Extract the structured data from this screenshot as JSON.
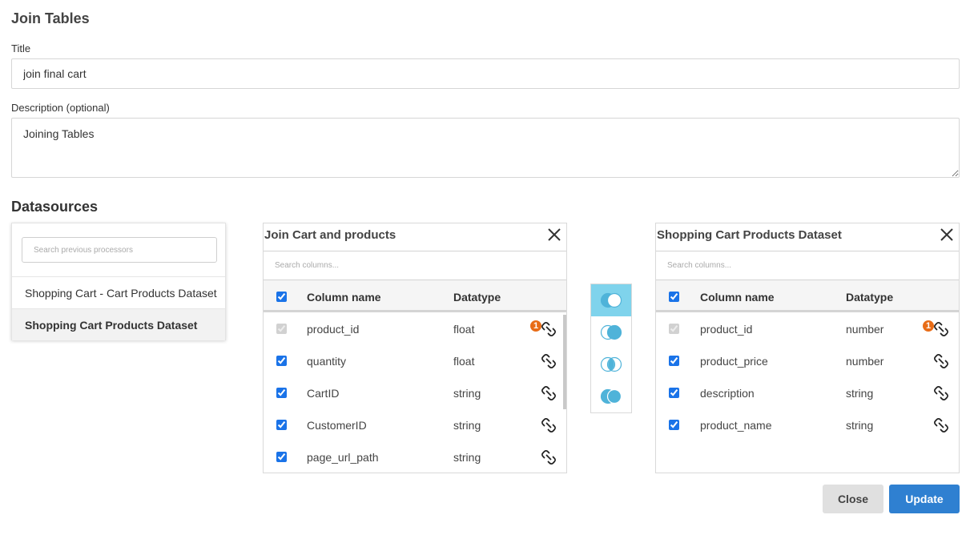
{
  "header": {
    "title": "Join Tables"
  },
  "form": {
    "title_label": "Title",
    "title_value": "join final cart",
    "description_label": "Description (optional)",
    "description_value": "Joining Tables"
  },
  "datasources": {
    "heading": "Datasources",
    "search_placeholder": "Search previous processors",
    "items": [
      {
        "label": "Shopping Cart - Cart Products Dataset",
        "active": false
      },
      {
        "label": "Shopping Cart Products Dataset",
        "active": true
      }
    ]
  },
  "left_table": {
    "title": "Join Cart and products",
    "search_placeholder": "Search columns...",
    "col_name_header": "Column name",
    "datatype_header": "Datatype",
    "rows": [
      {
        "name": "product_id",
        "type": "float",
        "checked": true,
        "disabled": true,
        "badge": "1"
      },
      {
        "name": "quantity",
        "type": "float",
        "checked": true,
        "disabled": false
      },
      {
        "name": "CartID",
        "type": "string",
        "checked": true,
        "disabled": false
      },
      {
        "name": "CustomerID",
        "type": "string",
        "checked": true,
        "disabled": false
      },
      {
        "name": "page_url_path",
        "type": "string",
        "checked": true,
        "disabled": false
      }
    ]
  },
  "right_table": {
    "title": "Shopping Cart Products Dataset",
    "search_placeholder": "Search columns...",
    "col_name_header": "Column name",
    "datatype_header": "Datatype",
    "rows": [
      {
        "name": "product_id",
        "type": "number",
        "checked": true,
        "disabled": true,
        "badge": "1"
      },
      {
        "name": "product_price",
        "type": "number",
        "checked": true,
        "disabled": false
      },
      {
        "name": "description",
        "type": "string",
        "checked": true,
        "disabled": false
      },
      {
        "name": "product_name",
        "type": "string",
        "checked": true,
        "disabled": false
      }
    ]
  },
  "join_types": {
    "options": [
      "left-join-icon",
      "right-join-icon",
      "inner-join-icon",
      "full-join-icon"
    ],
    "selected": 0
  },
  "actions": {
    "close_label": "Close",
    "update_label": "Update"
  },
  "colors": {
    "accent": "#2f80d1",
    "join_active": "#7fd3ec",
    "join_fill": "#4fb3d9",
    "badge": "#e86c17"
  }
}
